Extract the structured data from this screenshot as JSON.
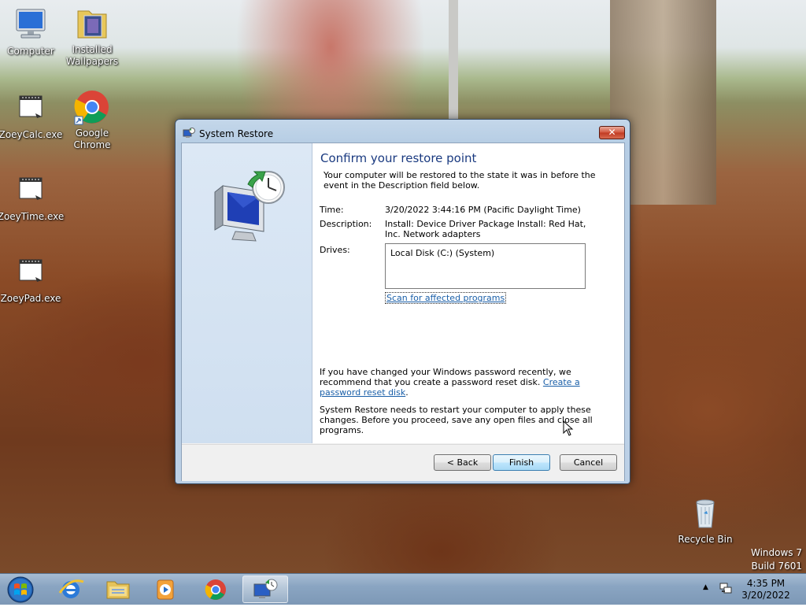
{
  "desktop": {
    "icons": [
      {
        "label": "Computer"
      },
      {
        "label": "Installed Wallpapers"
      },
      {
        "label": "ZoeyCalc.exe"
      },
      {
        "label": "Google Chrome"
      },
      {
        "label": "ZoeyTime.exe"
      },
      {
        "label": "ZoeyPad.exe"
      },
      {
        "label": "Recycle Bin"
      }
    ],
    "watermark_line1": "Windows 7",
    "watermark_line2": "Build 7601"
  },
  "dialog": {
    "title": "System Restore",
    "close_symbol": "✕",
    "heading": "Confirm your restore point",
    "intro": "Your computer will be restored to the state it was in before the event in the Description field below.",
    "time_label": "Time:",
    "time_value": "3/20/2022 3:44:16 PM (Pacific Daylight Time)",
    "description_label": "Description:",
    "description_value": "Install: Device Driver Package Install: Red Hat, Inc. Network adapters",
    "drives_label": "Drives:",
    "drives_value": "Local Disk (C:) (System)",
    "scan_link": "Scan for affected programs",
    "password_text_before": "If you have changed your Windows password recently, we recommend that you create a password reset disk. ",
    "password_link": "Create a password reset disk",
    "password_text_after": ".",
    "restart_text": "System Restore needs to restart your computer to apply these changes. Before you proceed, save any open files and close all programs.",
    "buttons": {
      "back": "< Back",
      "finish": "Finish",
      "cancel": "Cancel"
    }
  },
  "taskbar": {
    "items": [
      "start-orb",
      "internet-explorer-icon",
      "windows-explorer-icon",
      "media-player-icon",
      "chrome-icon",
      "system-restore-icon"
    ],
    "clock_time": "4:35 PM",
    "clock_date": "3/20/2022"
  }
}
